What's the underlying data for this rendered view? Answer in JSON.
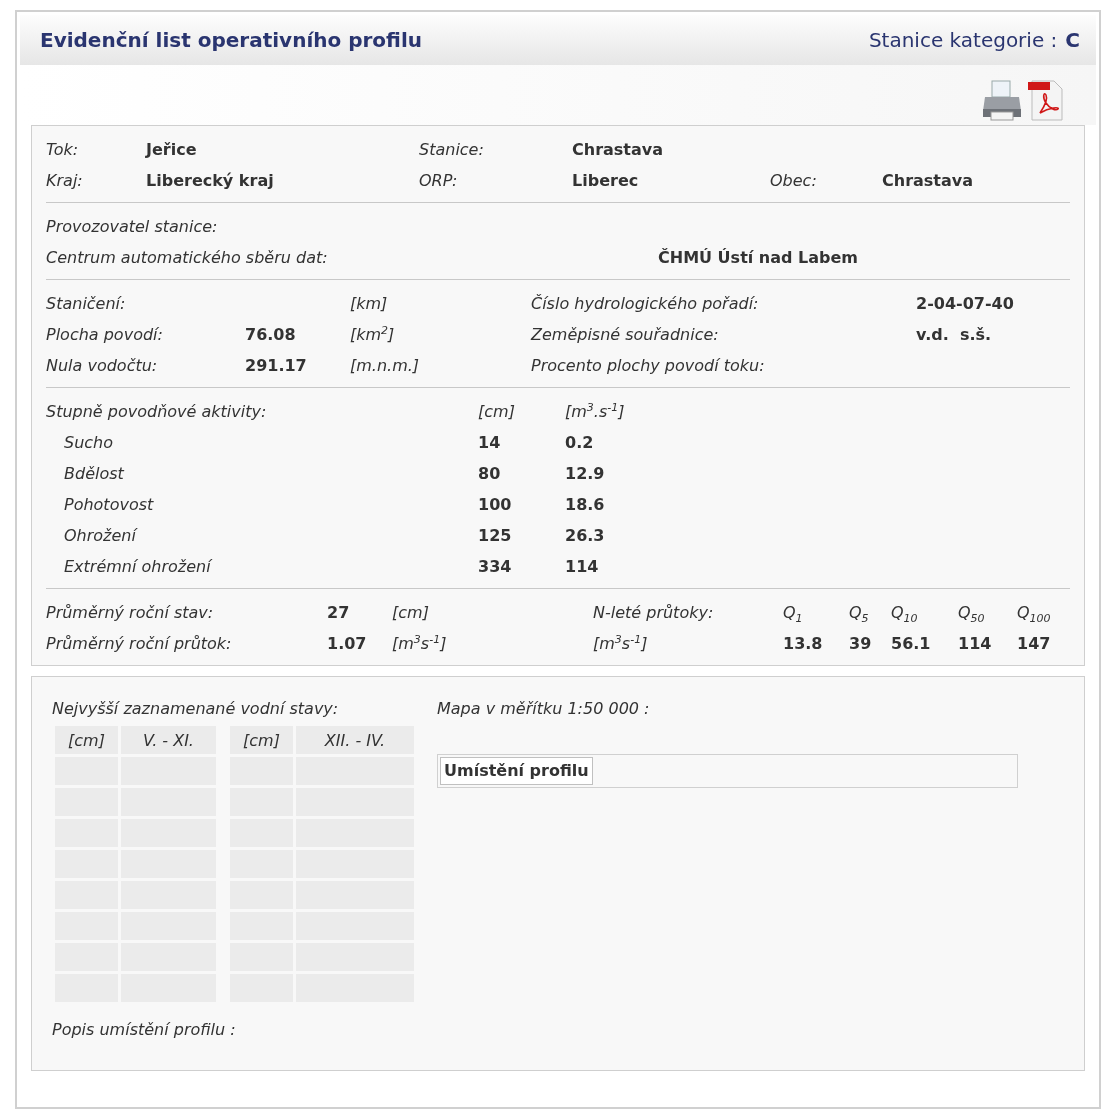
{
  "header": {
    "title": "Evidenční list operativního profilu",
    "category_label": "Stanice kategorie :",
    "category": "C"
  },
  "toolbar": [
    {
      "kind": "print"
    },
    {
      "kind": "pdf"
    }
  ],
  "basic": [
    [
      {
        "label": "Tok:",
        "value": "Jeřice"
      },
      {
        "label": "Stanice:",
        "value": "Chrastava"
      }
    ],
    [
      {
        "label": "Kraj:",
        "value": "Liberecký kraj"
      },
      {
        "label": "ORP:",
        "value": "Liberec"
      },
      {
        "label": "Obec:",
        "value": "Chrastava"
      }
    ]
  ],
  "operator": [
    {
      "label": "Provozovatel stanice:"
    },
    {
      "label": "Centrum automatického sběru dat:",
      "value": "ČHMÚ Ústí nad Labem"
    }
  ],
  "hydro": [
    {
      "label": "Staničení:",
      "unit": "[km]",
      "label2": "Číslo hydrologického pořadí:",
      "value2": "2-04-07-40"
    },
    {
      "label": "Plocha povodí:",
      "value": "76.08",
      "unit": "[km$^{2}$]",
      "label2": "Zeměpisné souřadnice:",
      "value2": "v.d.  s.š."
    },
    {
      "label": "Nula vodočtu:",
      "value": "291.17",
      "unit": "[m.n.m.]",
      "label2": "Procento plochy povodí toku:"
    }
  ],
  "flood": {
    "label": "Stupně povodňové aktivity:",
    "unit_level": "[cm]",
    "unit_flow": "[m$^{3}$.s$^{-1}$]",
    "rows": [
      {
        "name": "Sucho",
        "level": "14",
        "flow": "0.2"
      },
      {
        "name": "Bdělost",
        "level": "80",
        "flow": "12.9"
      },
      {
        "name": "Pohotovost",
        "level": "100",
        "flow": "18.6"
      },
      {
        "name": "Ohrožení",
        "level": "125",
        "flow": "26.3"
      },
      {
        "name": "Extrémní ohrožení",
        "level": "334",
        "flow": "114"
      }
    ]
  },
  "annual": [
    {
      "label": "Průměrný roční stav:",
      "value": "27",
      "unit": "[cm]"
    },
    {
      "label": "Průměrný roční průtok:",
      "value": "1.07",
      "unit": "[m$^{3}$s$^{-1}$]"
    }
  ],
  "nyear": {
    "label": "N-leté průtoky:",
    "unit": "[m$^{3}$s$^{-1}$]",
    "headers": [
      "Q$_{1}$",
      "Q$_{5}$",
      "Q$_{10}$",
      "Q$_{50}$",
      "Q$_{100}$"
    ],
    "values": [
      "13.8",
      "39",
      "56.1",
      "114",
      "147"
    ]
  },
  "records": {
    "title": "Nejvyšší zaznamenané vodní stavy:",
    "tables": [
      {
        "columns": [
          "[cm]",
          "V. - XI."
        ]
      },
      {
        "columns": [
          "[cm]",
          "XII. - IV."
        ]
      }
    ]
  },
  "map": {
    "title": "Mapa v měřítku 1:50 000 :",
    "caption": "Umístění profilu"
  },
  "description": {
    "label": "Popis umístění profilu :"
  }
}
